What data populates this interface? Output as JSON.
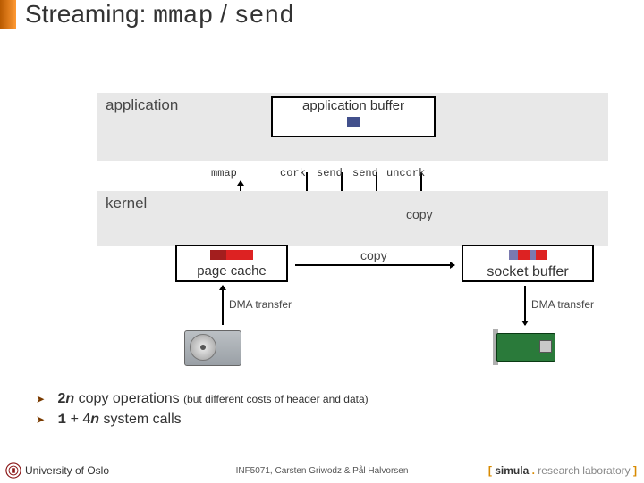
{
  "title": {
    "prefix": "Streaming: ",
    "fn1": "mmap",
    "sep": " / ",
    "fn2": "send"
  },
  "labels": {
    "application": "application",
    "application_buffer": "application buffer",
    "kernel": "kernel",
    "page_cache": "page cache",
    "socket_buffer": "socket buffer",
    "dma_transfer_left": "DMA transfer",
    "dma_transfer_right": "DMA transfer",
    "copy1": "copy",
    "copy2": "copy"
  },
  "calls": {
    "mmap": "mmap",
    "cork": "cork",
    "send1": "send",
    "send2": "send",
    "uncork": "uncork"
  },
  "bullets": {
    "line1_prefix": "2",
    "line1_n": "n",
    "line1_rest": " copy operations ",
    "line1_small": "(but different costs of header and data)",
    "line2_prefix": "1",
    "line2_mid": " + 4",
    "line2_n": "n",
    "line2_rest": " system calls"
  },
  "footer": {
    "uo": "University of Oslo",
    "mid": "INF5071, Carsten Griwodz & Pål Halvorsen",
    "brand_open": "[ ",
    "brand_name": "simula",
    "brand_dot": " . ",
    "brand_rest": "research laboratory ",
    "brand_close": "]"
  }
}
